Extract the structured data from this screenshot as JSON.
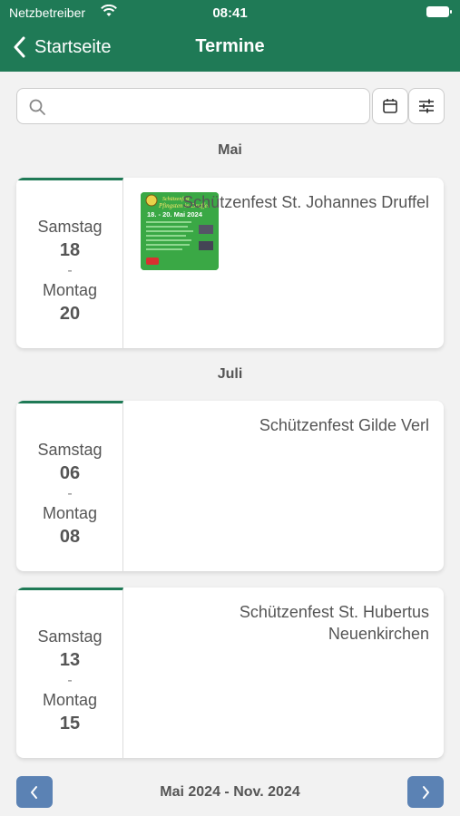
{
  "status_bar": {
    "carrier": "Netzbetreiber",
    "time": "08:41"
  },
  "nav": {
    "back_label": "Startseite",
    "title": "Termine"
  },
  "search": {
    "placeholder": ""
  },
  "groups": [
    {
      "month": "Mai"
    },
    {
      "month": "Juli"
    }
  ],
  "events": [
    {
      "start_day": "Samstag",
      "start_date": "18",
      "separator": "-",
      "end_day": "Montag",
      "end_date": "20",
      "title": "Schützenfest St. Johannes Druffel",
      "has_thumbnail": true,
      "thumbnail": {
        "line1": "Schützenfest",
        "line2": "Pfingsten in Druffel",
        "line3": "18. - 20. Mai 2024"
      }
    },
    {
      "start_day": "Samstag",
      "start_date": "06",
      "separator": "-",
      "end_day": "Montag",
      "end_date": "08",
      "title": "Schützenfest Gilde Verl",
      "has_thumbnail": false
    },
    {
      "start_day": "Samstag",
      "start_date": "13",
      "separator": "-",
      "end_day": "Montag",
      "end_date": "15",
      "title": "Schützenfest St. Hubertus Neuenkirchen",
      "has_thumbnail": false
    }
  ],
  "pager": {
    "range_label": "Mai 2024 - Nov. 2024"
  },
  "colors": {
    "header": "#1f7a56",
    "accent": "#1f7a56",
    "pager_button": "#5b82b4",
    "background": "#f2f2f2"
  },
  "icons": {
    "back": "chevron-left-icon",
    "search": "search-icon",
    "calendar": "calendar-icon",
    "filter": "sliders-icon",
    "prev": "chevron-left-icon",
    "next": "chevron-right-icon"
  }
}
